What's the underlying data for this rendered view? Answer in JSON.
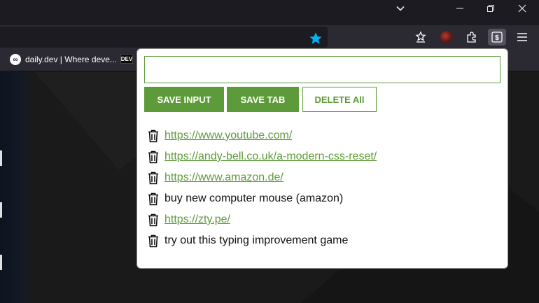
{
  "bookmarks": [
    {
      "icon": "daily-dev-favicon",
      "label": "daily.dev | Where deve..."
    },
    {
      "icon": "dev-favicon",
      "label": "DEV"
    }
  ],
  "popup": {
    "input_value": "",
    "buttons": {
      "save_input": "SAVE INPUT",
      "save_tab": "SAVE TAB",
      "delete_all": "DELETE All"
    },
    "items": [
      {
        "text": "https://www.youtube.com/",
        "is_link": true
      },
      {
        "text": "https://andy-bell.co.uk/a-modern-css-reset/",
        "is_link": true
      },
      {
        "text": "https://www.amazon.de/",
        "is_link": true
      },
      {
        "text": "buy new computer mouse (amazon)",
        "is_link": false
      },
      {
        "text": "https://zty.pe/",
        "is_link": true
      },
      {
        "text": "try out this typing improvement game",
        "is_link": false
      }
    ]
  },
  "colors": {
    "accent": "#5d9b3a",
    "star": "#00b3f4",
    "chrome_bg": "#2b2a33",
    "titlebar_bg": "#1c1b22"
  }
}
